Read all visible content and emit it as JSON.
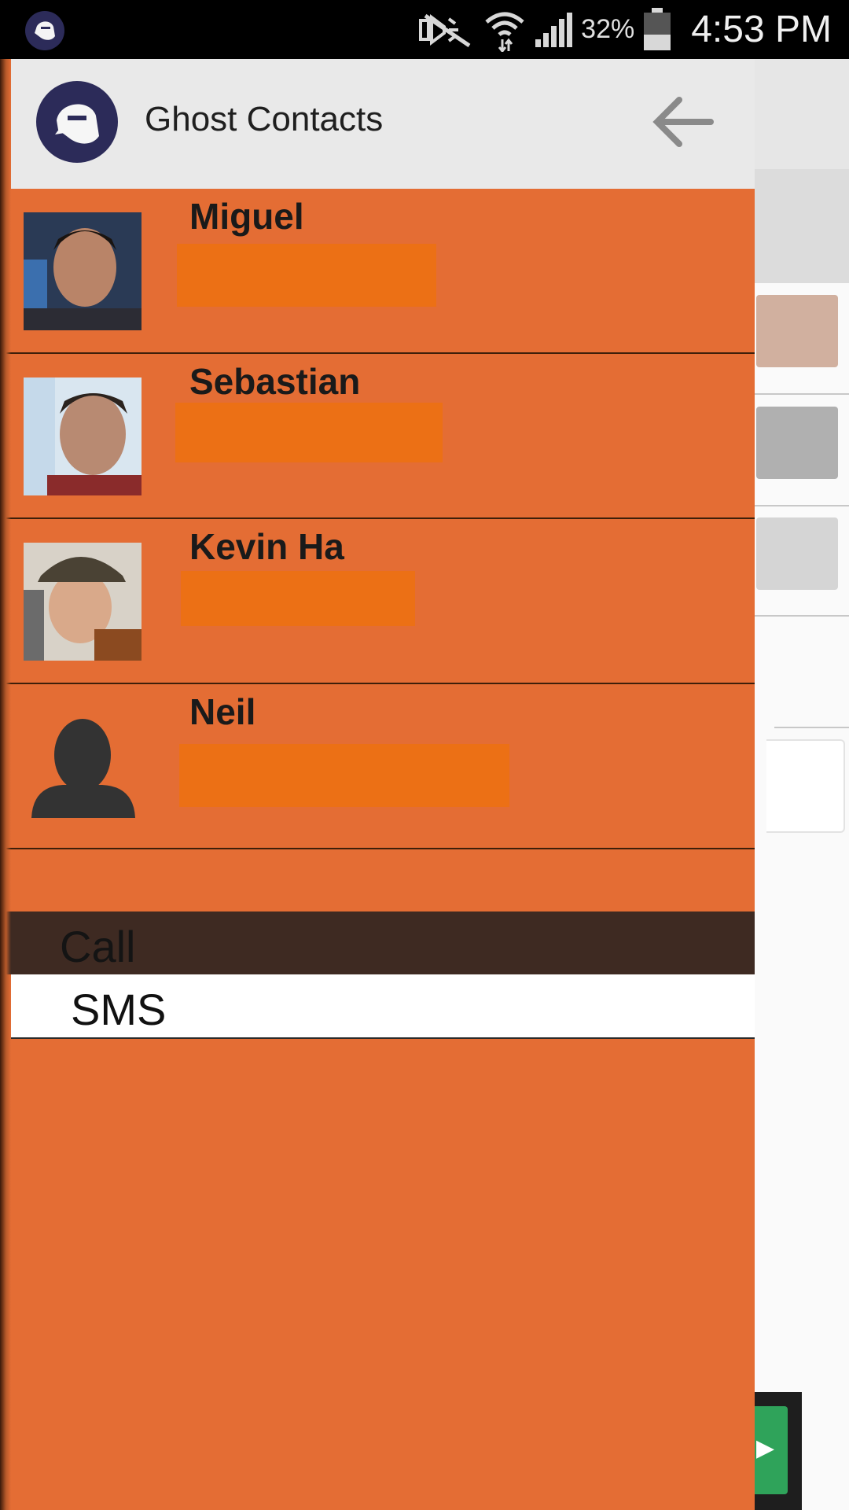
{
  "status_bar": {
    "battery": "32%",
    "time": "4:53 PM",
    "icons": [
      "ghost-app-icon",
      "mute-icon",
      "wifi-icon",
      "signal-icon",
      "battery-icon"
    ]
  },
  "drawer": {
    "title": "Ghost Contacts",
    "contacts": [
      {
        "name": "Miguel",
        "photo": "photo"
      },
      {
        "name": "Sebastian",
        "photo": "photo"
      },
      {
        "name": "Kevin Ha",
        "photo": "photo"
      },
      {
        "name": "Neil",
        "photo": "default-avatar"
      }
    ],
    "menu": {
      "call": "Call",
      "sms": "SMS"
    }
  },
  "colors": {
    "drawer_bg": "#e46d34",
    "redaction": "#ec7015",
    "call_bg": "#3e2a22",
    "header_bg": "#e9e9e9"
  }
}
